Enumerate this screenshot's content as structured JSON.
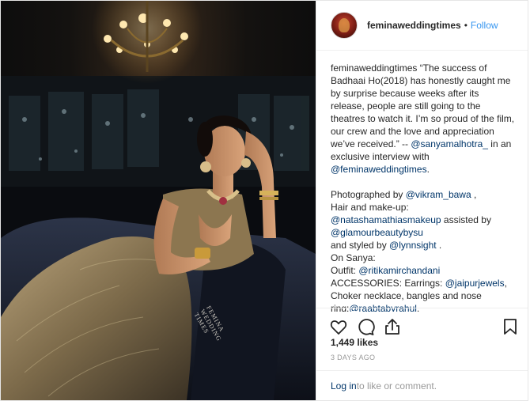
{
  "header": {
    "username": "feminaweddingtimes",
    "separator": "•",
    "follow_label": "Follow"
  },
  "caption": {
    "username": "feminaweddingtimes",
    "body_1": " “The success of Badhaai Ho(2018) has honestly caught me by surprise because weeks after its release, people are still going to the theatres to watch it. I’m so proud of the film, our crew and the love and appreciation we’ve received.” -- ",
    "mention_1": "@sanyamalhotra_",
    "body_2": " in an exclusive interview with ",
    "mention_2": "@feminaweddingtimes",
    "body_3": ".",
    "photo_prefix": "Photographed by ",
    "mention_3": "@vikram_bawa",
    "photo_suffix": " ,",
    "hair_label": "Hair and make-up:",
    "mention_4": "@natashamathiasmakeup",
    "assisted": " assisted by",
    "mention_5": "@glamourbeautybysu",
    "styled_prefix": "and styled by ",
    "mention_6": "@lynnsight",
    "styled_suffix": " .",
    "on_sanya": "On Sanya:",
    "outfit_prefix": "Outfit: ",
    "mention_7": "@ritikamirchandani",
    "accessories_prefix": "ACCESSORIES: Earrings: ",
    "mention_8": "@jaipurjewels",
    "accessories_suffix": ",",
    "choker": "Choker necklace, bangles and nose",
    "ring_prefix": "ring:",
    "mention_9": "@raabtabyrahul",
    "ring_suffix": ","
  },
  "actions": {
    "like_icon": "heart-icon",
    "comment_icon": "comment-icon",
    "share_icon": "share-icon",
    "save_icon": "bookmark-icon"
  },
  "likes": "1,449 likes",
  "timestamp": "3 DAYS AGO",
  "footer": {
    "login_label": "Log in",
    "login_suffix": " to like or comment."
  },
  "photo": {
    "watermark": "FEMINA WEDDING TIMES"
  }
}
